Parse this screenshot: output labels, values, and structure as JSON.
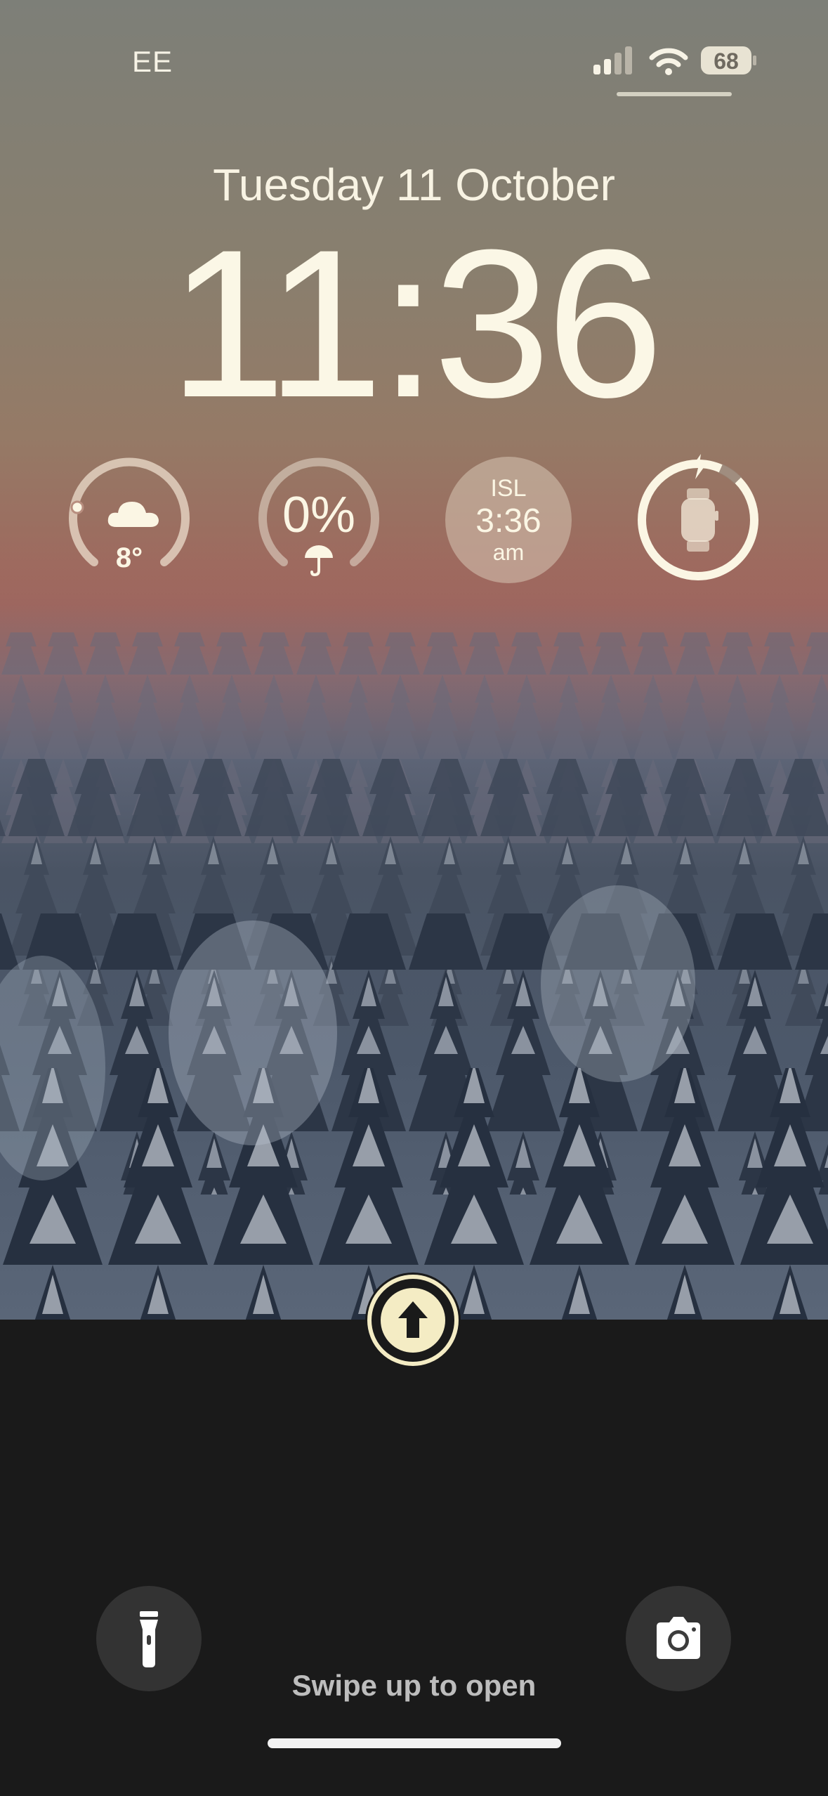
{
  "status_bar": {
    "carrier": "EE",
    "battery_level": "68",
    "signal_icon": "cellular-signal-icon",
    "wifi_icon": "wifi-icon"
  },
  "lock_screen": {
    "date": "Tuesday 11 October",
    "time": "11:36"
  },
  "widgets": {
    "weather": {
      "temperature": "8°",
      "icon": "cloud-icon"
    },
    "rain": {
      "chance": "0%",
      "icon": "umbrella-icon"
    },
    "world_clock": {
      "city": "ISL",
      "time": "3:36",
      "period": "am"
    },
    "watch_battery": {
      "icon": "apple-watch-icon",
      "charging_icon": "bolt-icon"
    }
  },
  "bottom": {
    "swipe_hint": "Swipe up to open",
    "flashlight_icon": "flashlight-icon",
    "camera_icon": "camera-icon",
    "up_button_icon": "arrow-up-icon"
  },
  "colors": {
    "accent": "#f4ecc4",
    "text": "#fbf6e4",
    "bottom_background": "#1a1a1a"
  }
}
